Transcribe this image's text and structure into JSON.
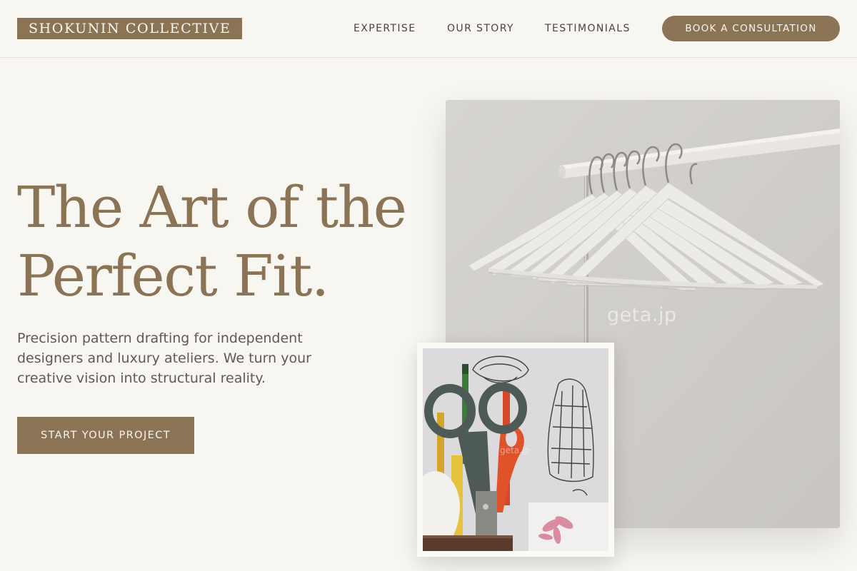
{
  "header": {
    "logo": "SHOKUNIN COLLECTIVE",
    "nav": {
      "expertise": "EXPERTISE",
      "story": "OUR STORY",
      "testimonials": "TESTIMONIALS"
    },
    "cta": "BOOK A CONSULTATION"
  },
  "hero": {
    "title_line1": "The Art of the",
    "title_line2": "Perfect Fit.",
    "subtitle": "Precision pattern drafting for independent designers and luxury ateliers. We turn your creative vision into structural reality.",
    "button": "START YOUR PROJECT"
  },
  "images": {
    "main_watermark": "geta.jp",
    "small_watermark": "geta.jp"
  },
  "colors": {
    "background": "#f8f6f1",
    "accent": "#8b7355",
    "text": "#4a4540"
  }
}
